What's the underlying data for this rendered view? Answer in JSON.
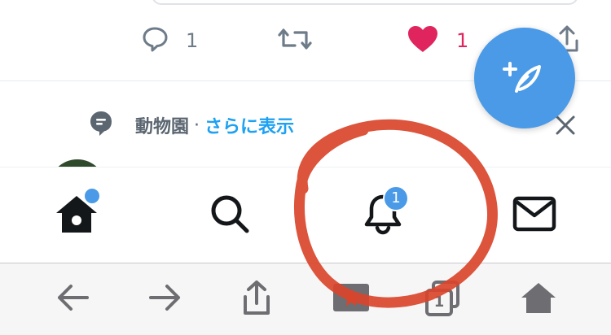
{
  "tweet_actions": {
    "reply_count": "1",
    "like_count": "1",
    "like_color": "#e0245e",
    "icons": [
      "reply-icon",
      "retweet-icon",
      "heart-icon",
      "share-icon"
    ]
  },
  "topic_row": {
    "topic": "動物園",
    "separator": "·",
    "more_label": "さらに表示",
    "icons": [
      "topic-icon",
      "close-icon"
    ]
  },
  "compose": {
    "icon": "compose-feather-icon",
    "color": "#4a9ae8"
  },
  "tab_bar": {
    "tabs": [
      {
        "name": "home",
        "icon": "home-icon",
        "has_dot": true
      },
      {
        "name": "search",
        "icon": "search-icon"
      },
      {
        "name": "notifications",
        "icon": "bell-icon",
        "badge": "1"
      },
      {
        "name": "messages",
        "icon": "mail-icon"
      }
    ],
    "accent": "#4a9ae8"
  },
  "browser_toolbar": {
    "buttons": [
      "back-arrow-icon",
      "forward-arrow-icon",
      "share-icon",
      "bookmark-icon",
      "tabs-icon",
      "home-icon"
    ],
    "tabs_count": "1"
  },
  "annotation": {
    "shape": "hand-drawn circle around notifications tab",
    "color": "#d9452b"
  }
}
